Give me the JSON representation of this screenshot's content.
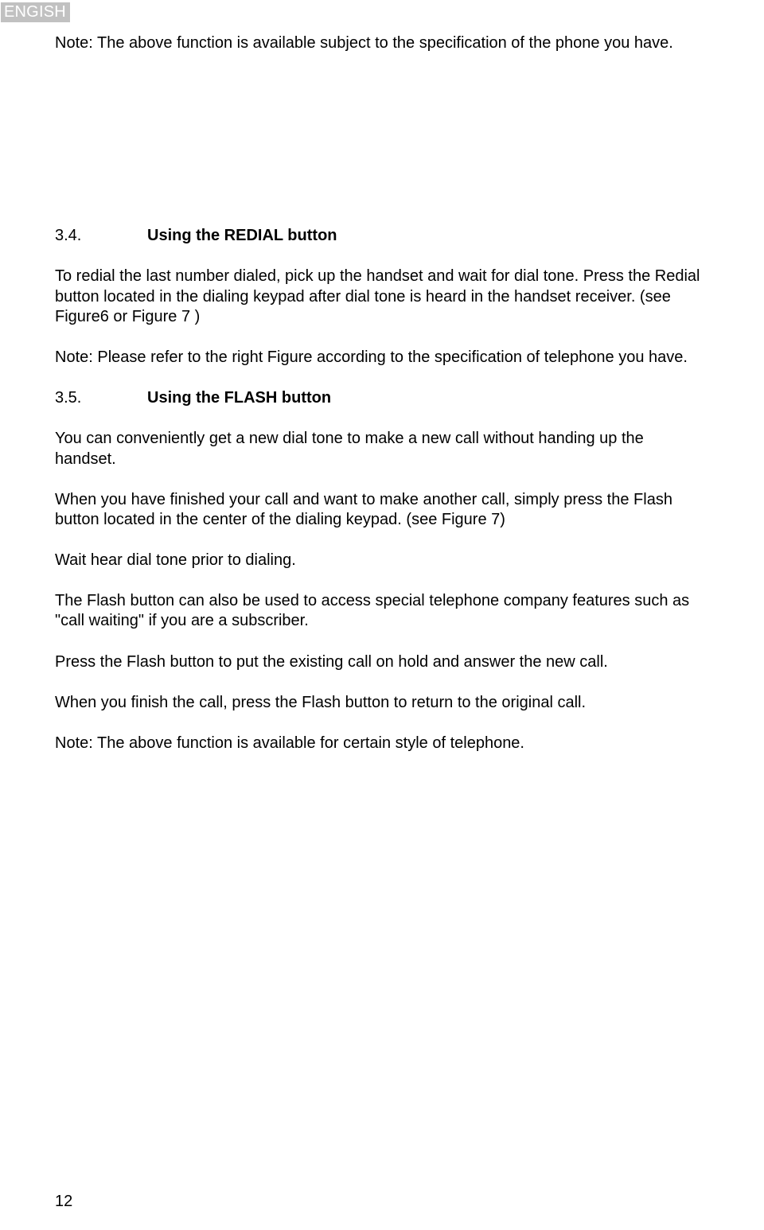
{
  "tab": "ENGISH",
  "p1": "Note: The above function is available subject to the specification of the phone you have.",
  "s34_num": "3.4.",
  "s34_title": "Using the REDIAL button",
  "s34_p1": "To redial the last number dialed, pick up the handset and wait for dial tone. Press the Redial button located in the dialing keypad after dial tone is heard in the handset receiver. (see Figure6 or Figure 7 )",
  "s34_p2": "Note: Please refer to the right Figure according to the specification of telephone you have.",
  "s35_num": "3.5.",
  "s35_title": "Using the FLASH button",
  "s35_p1": "You can conveniently get a new dial tone to make a new call without handing up the handset.",
  "s35_p2": "When you have finished your call and want to make another call, simply press the Flash button located in the center of the dialing keypad. (see Figure 7)",
  "s35_p3": "Wait hear dial tone prior to dialing.",
  "s35_p4": "The Flash button can also be used to access special telephone company features such as \"call waiting\" if you are a subscriber.",
  "s35_p5": "Press the Flash button to put the existing call on hold and answer the new call.",
  "s35_p6": "When you finish the call, press the Flash button to return to the original call.",
  "s35_p7": "Note: The above function is available for certain style of telephone.",
  "page_number": "12"
}
